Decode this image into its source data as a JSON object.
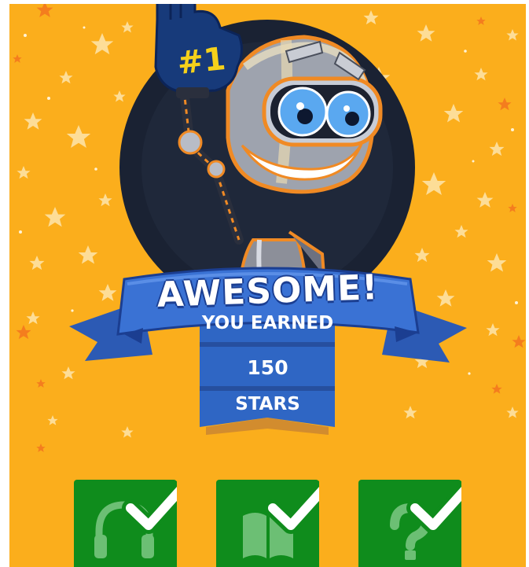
{
  "reward": {
    "title": "AWESOME!",
    "earned_label": "YOU EARNED",
    "amount": "150",
    "unit_label": "STARS"
  },
  "mascot": {
    "finger_sign_text": "#1"
  },
  "activities": [
    {
      "icon": "headphones-icon",
      "completed": true
    },
    {
      "icon": "book-icon",
      "completed": true
    },
    {
      "icon": "question-mark-icon",
      "completed": true
    }
  ],
  "colors": {
    "background": "#fbae1c",
    "ribbon": "#3369c9",
    "ribbon_dark": "#1b3e91",
    "badge_green": "#0f8c1c",
    "check_white": "#ffffff"
  }
}
